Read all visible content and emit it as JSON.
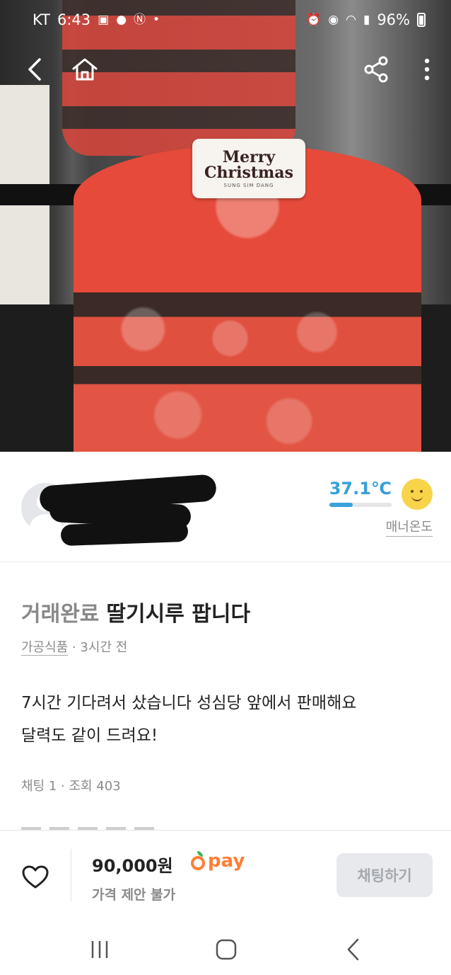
{
  "status_bar": {
    "carrier": "KT",
    "time": "6:43",
    "battery": "96%"
  },
  "product_image": {
    "topper_line1": "Merry",
    "topper_line2": "Christmas",
    "topper_brand": "SUNG SIM DANG"
  },
  "seller": {
    "temperature": "37.1℃",
    "temperature_level": 0.37,
    "manner_label": "매너온도"
  },
  "post": {
    "status": "거래완료",
    "title": "딸기시루 팝니다",
    "category": "가공식품",
    "time_ago": "· 3시간 전",
    "description": "7시간 기다려서 샀습니다 성심당 앞에서 판매해요\n 달력도 같이 드려요!",
    "stats": "채팅 1 · 조회 403"
  },
  "action_bar": {
    "price": "90,000원",
    "pay_label": "pay",
    "price_note": "가격 제안 불가",
    "chat_button": "채팅하기"
  },
  "colors": {
    "accent": "#ff7e36",
    "temperature": "#35a0d8"
  }
}
